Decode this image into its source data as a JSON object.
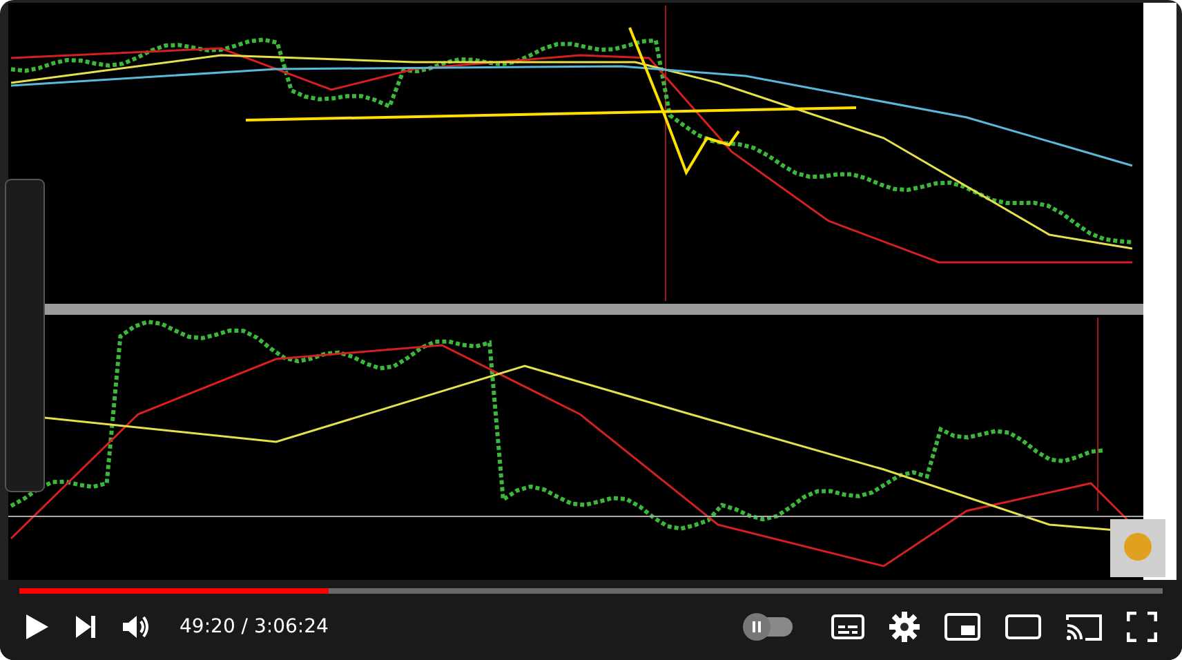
{
  "player": {
    "progress": {
      "level": 0.27
    },
    "time": "49:20 / 3:06:24",
    "autoplay": {
      "on": false
    }
  }
}
